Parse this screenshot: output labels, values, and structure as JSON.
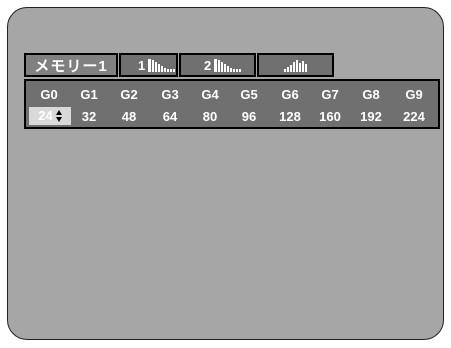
{
  "tabs": [
    {
      "label": "メモリー1",
      "kind": "text",
      "active": true
    },
    {
      "label": "1",
      "kind": "bars-icon",
      "icon": "tone-curve-1-icon"
    },
    {
      "label": "2",
      "kind": "bars-icon",
      "icon": "tone-curve-2-icon"
    },
    {
      "label": "",
      "kind": "bars-icon",
      "icon": "histogram-icon"
    }
  ],
  "gamma": {
    "headers": [
      "G0",
      "G1",
      "G2",
      "G3",
      "G4",
      "G5",
      "G6",
      "G7",
      "G8",
      "G9"
    ],
    "values": [
      "24",
      "32",
      "48",
      "64",
      "80",
      "96",
      "128",
      "160",
      "192",
      "224"
    ],
    "selected_index": 0
  },
  "colors": {
    "background": "#a6a6a6",
    "panel": "#707070",
    "text": "#ffffff",
    "selected_cell": "#d9d9d9"
  }
}
